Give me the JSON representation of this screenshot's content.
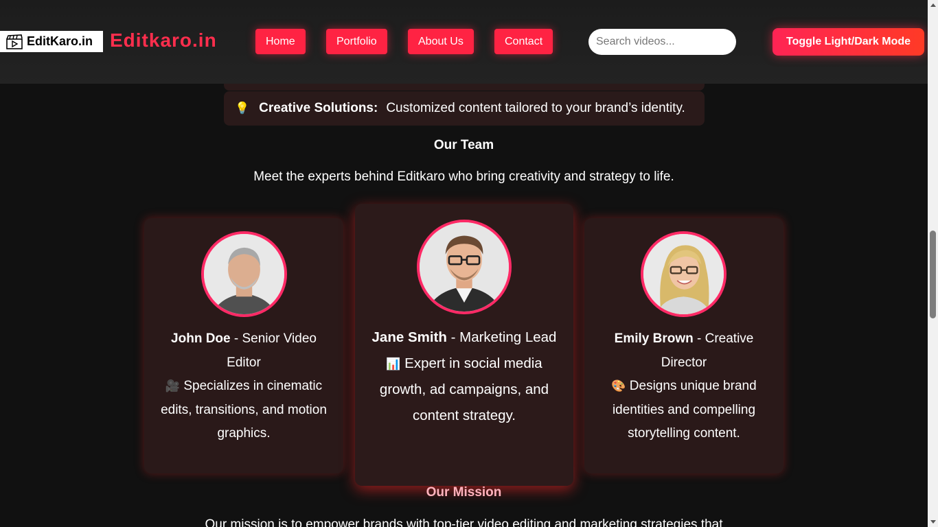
{
  "header": {
    "logo_text": "EditKaro.in",
    "brand": "Editkaro.in",
    "nav": [
      "Home",
      "Portfolio",
      "About Us",
      "Contact"
    ],
    "search_placeholder": "Search videos...",
    "toggle_label": "Toggle Light/Dark Mode"
  },
  "feature": {
    "icon": "lightbulb-icon",
    "title": "Creative Solutions:",
    "text": "Customized content tailored to your brand’s identity."
  },
  "team": {
    "title": "Our Team",
    "description": "Meet the experts behind Editkaro who bring creativity and strategy to life.",
    "members": [
      {
        "name": "John Doe",
        "role": "- Senior Video Editor",
        "emoji": "🎥",
        "bio": "Specializes in cinematic edits, transitions, and motion graphics."
      },
      {
        "name": "Jane Smith",
        "role": "- Marketing Lead",
        "emoji": "📊",
        "bio": "Expert in social media growth, ad campaigns, and content strategy."
      },
      {
        "name": "Emily Brown",
        "role": "- Creative Director",
        "emoji": "🎨",
        "bio": "Designs unique brand identities and compelling storytelling content."
      }
    ]
  },
  "mission": {
    "title": "Our Mission",
    "text": "Our mission is to empower brands with top-tier video editing and marketing strategies that"
  },
  "colors": {
    "accent": "#ff2343",
    "background": "#111111",
    "card": "#2a1919",
    "avatar_border": "#ff2a66"
  }
}
